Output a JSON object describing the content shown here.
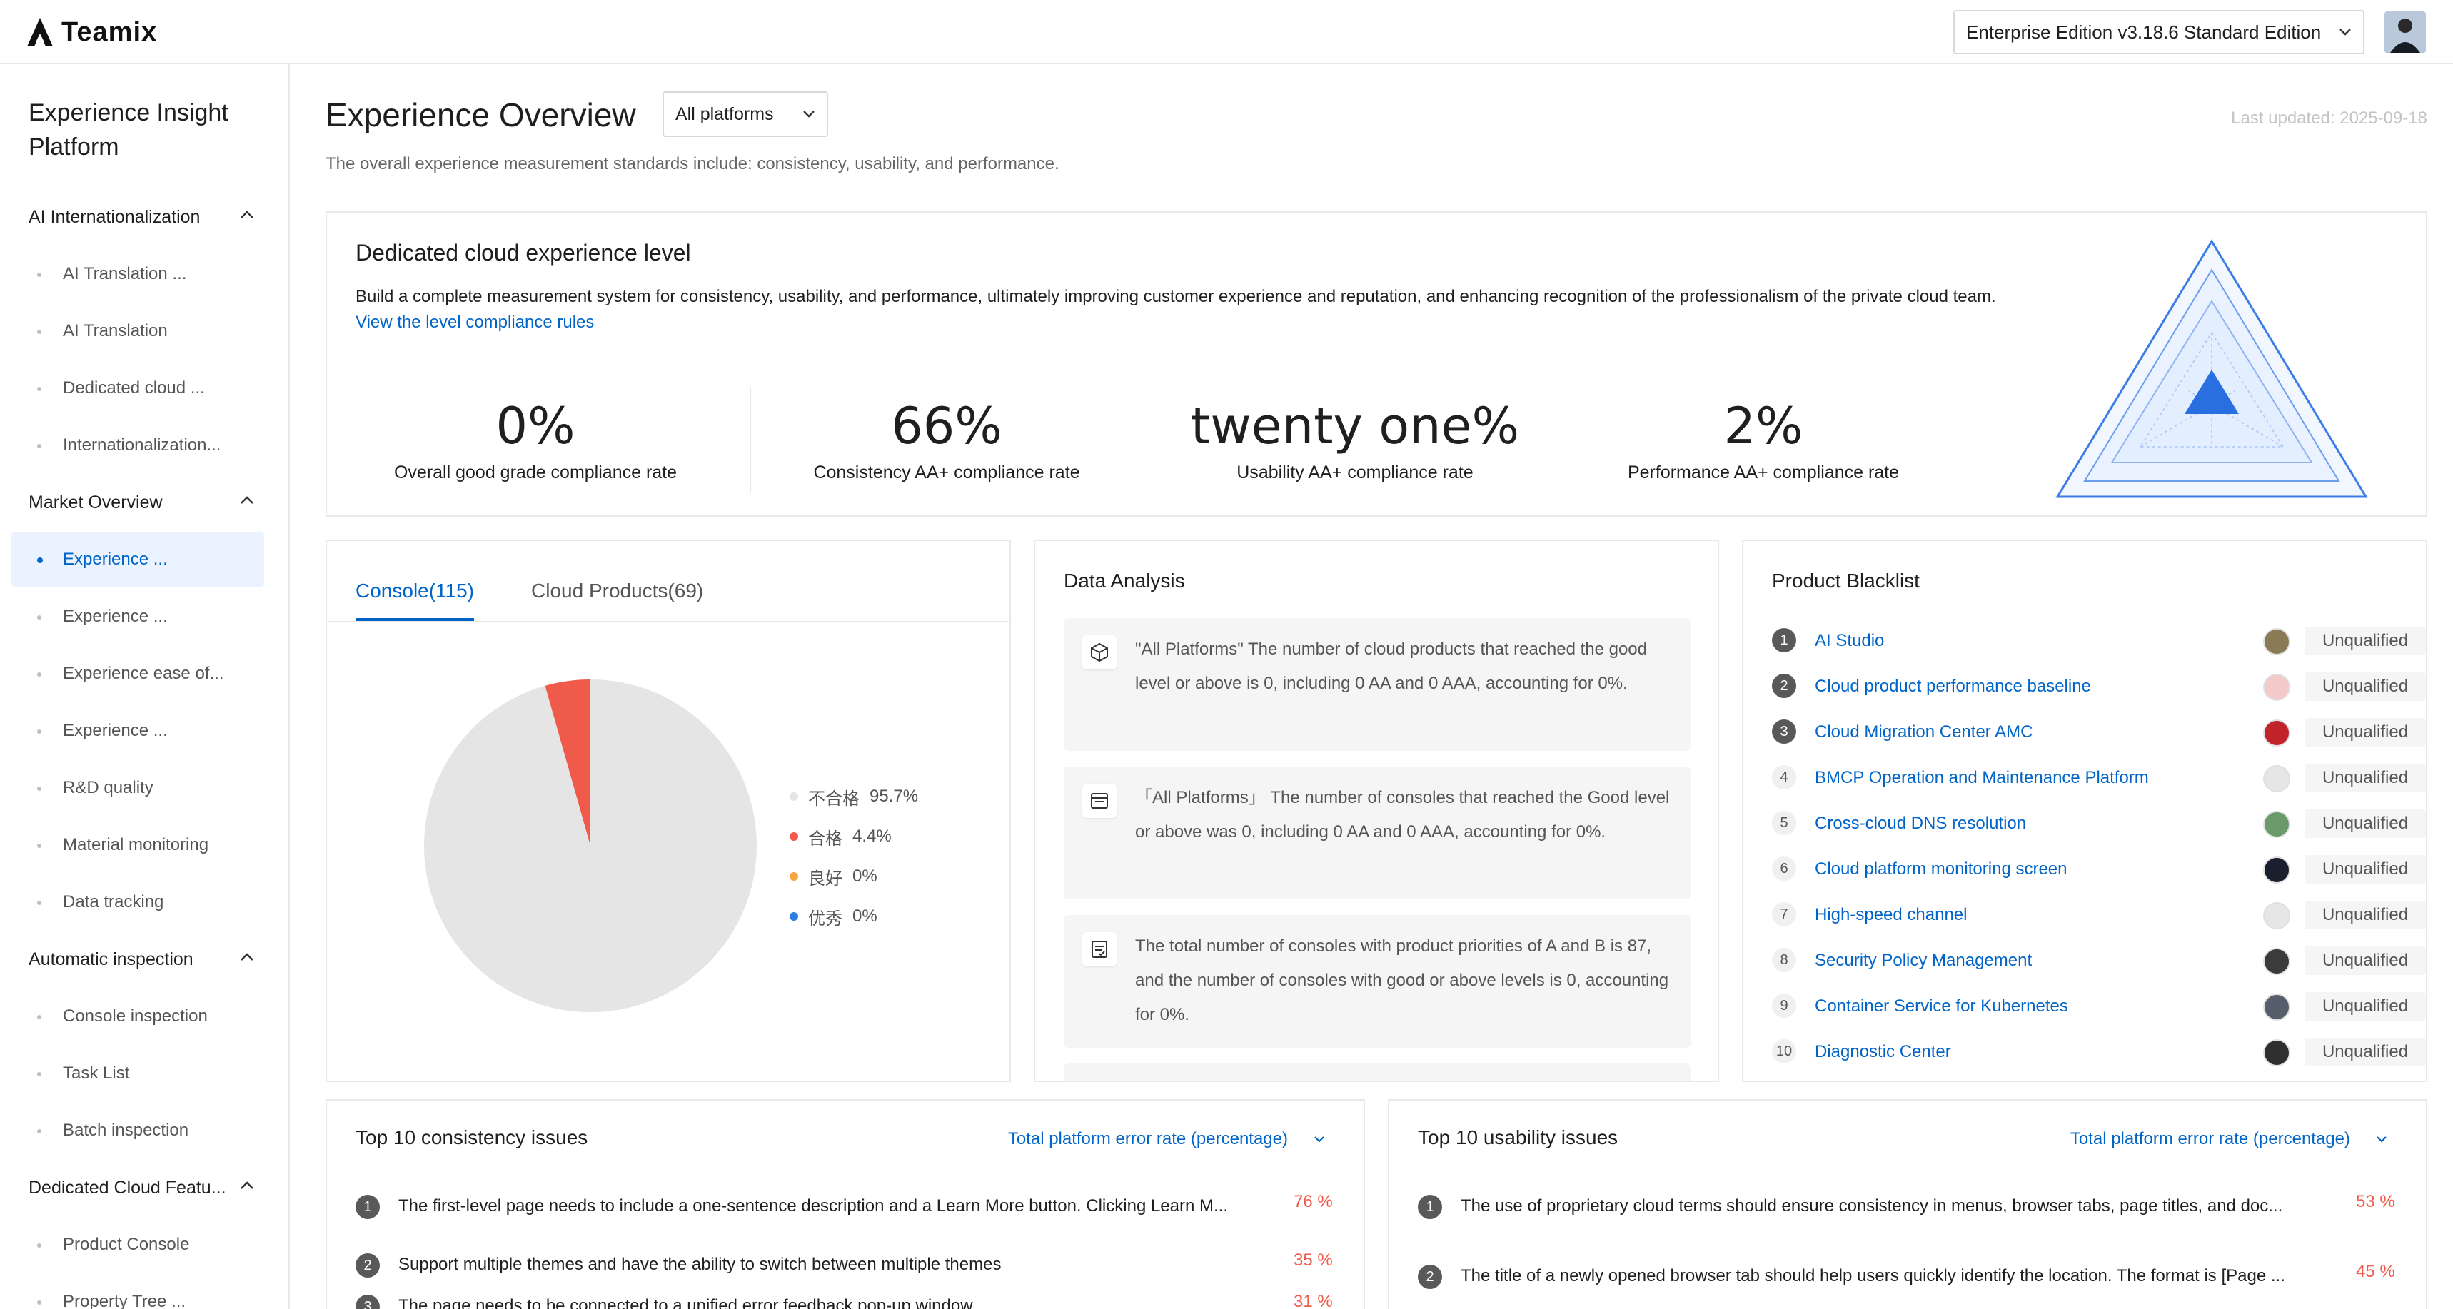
{
  "app": {
    "logo_text": "Teamix",
    "edition": "Enterprise Edition v3.18.6 Standard Edition"
  },
  "sidebar": {
    "title": "Experience Insight Platform",
    "groups": [
      {
        "label": "AI Internationalization",
        "items": [
          {
            "label": "AI Translation ..."
          },
          {
            "label": "AI Translation"
          },
          {
            "label": "Dedicated cloud ..."
          },
          {
            "label": "Internationalization..."
          }
        ]
      },
      {
        "label": "Market Overview",
        "items": [
          {
            "label": "Experience ...",
            "active": true
          },
          {
            "label": "Experience ..."
          },
          {
            "label": "Experience ease of..."
          },
          {
            "label": "Experience ..."
          },
          {
            "label": "R&D quality"
          },
          {
            "label": "Material monitoring"
          },
          {
            "label": "Data tracking"
          }
        ]
      },
      {
        "label": "Automatic inspection",
        "items": [
          {
            "label": "Console inspection"
          },
          {
            "label": "Task List"
          },
          {
            "label": "Batch inspection"
          }
        ]
      },
      {
        "label": "Dedicated Cloud Featu...",
        "items": [
          {
            "label": "Product Console"
          },
          {
            "label": "Property Tree ..."
          }
        ]
      }
    ]
  },
  "header": {
    "title": "Experience Overview",
    "platform_select": "All platforms",
    "last_updated": "Last updated: 2025-09-18",
    "subtitle": "The overall experience measurement standards include: consistency, usability, and performance."
  },
  "level": {
    "title": "Dedicated cloud experience level",
    "desc": "Build a complete measurement system for consistency, usability, and performance, ultimately improving customer experience and reputation, and enhancing recognition of the professionalism of the private cloud team.",
    "link": "View the level compliance rules",
    "metrics": [
      {
        "value": "0%",
        "label": "Overall good grade compliance rate"
      },
      {
        "value": "66%",
        "label": "Consistency AA+ compliance rate"
      },
      {
        "value": "twenty one%",
        "label": "Usability AA+ compliance rate"
      },
      {
        "value": "2%",
        "label": "Performance AA+ compliance rate"
      }
    ]
  },
  "tabs": {
    "items": [
      {
        "label": "Console(115)",
        "active": true
      },
      {
        "label": "Cloud Products(69)",
        "active": false
      }
    ]
  },
  "chart_data": {
    "type": "pie",
    "slices": [
      {
        "label": "不合格",
        "value": 95.7,
        "display": "95.7%",
        "color": "#e5e5e5"
      },
      {
        "label": "合格",
        "value": 4.4,
        "display": "4.4%",
        "color": "#f05a4a"
      },
      {
        "label": "良好",
        "value": 0,
        "display": "0%",
        "color": "#f7a541"
      },
      {
        "label": "优秀",
        "value": 0,
        "display": "0%",
        "color": "#2a7de1"
      }
    ]
  },
  "analysis": {
    "title": "Data Analysis",
    "items": [
      {
        "icon": "cube-icon",
        "text": "\"All Platforms\" The number of cloud products that reached the good level or above is 0, including 0 AA and 0 AAA, accounting for 0%."
      },
      {
        "icon": "window-icon",
        "text": "「All Platforms」 The number of consoles that reached the Good level or above was 0, including 0 AA and 0 AAA, accounting for 0%."
      },
      {
        "icon": "document-icon",
        "text": "The total number of consoles with product priorities of A and B is 87, and the number of consoles with good or above levels is 0, accounting for 0%."
      }
    ]
  },
  "blacklist": {
    "title": "Product Blacklist",
    "rows": [
      {
        "rank": "1",
        "name": "AI Studio",
        "status": "Unqualified"
      },
      {
        "rank": "2",
        "name": "Cloud product performance baseline",
        "status": "Unqualified"
      },
      {
        "rank": "3",
        "name": "Cloud Migration Center AMC",
        "status": "Unqualified"
      },
      {
        "rank": "4",
        "name": "BMCP Operation and Maintenance Platform",
        "status": "Unqualified"
      },
      {
        "rank": "5",
        "name": "Cross-cloud DNS resolution",
        "status": "Unqualified"
      },
      {
        "rank": "6",
        "name": "Cloud platform monitoring screen",
        "status": "Unqualified"
      },
      {
        "rank": "7",
        "name": "High-speed channel",
        "status": "Unqualified"
      },
      {
        "rank": "8",
        "name": "Security Policy Management",
        "status": "Unqualified"
      },
      {
        "rank": "9",
        "name": "Container Service for Kubernetes",
        "status": "Unqualified"
      },
      {
        "rank": "10",
        "name": "Diagnostic Center",
        "status": "Unqualified"
      }
    ]
  },
  "consistency": {
    "title": "Top 10 consistency issues",
    "select": "Total platform error rate (percentage)",
    "items": [
      {
        "rank": "1",
        "text": "The first-level page needs to include a one-sentence description and a Learn More button. Clicking Learn M...",
        "pct": "76 %"
      },
      {
        "rank": "2",
        "text": "Support multiple themes and have the ability to switch between multiple themes",
        "pct": "35 %"
      },
      {
        "rank": "3",
        "text": "The page needs to be connected to a unified error feedback pop-up window",
        "pct": "31 %"
      }
    ]
  },
  "usability": {
    "title": "Top 10 usability issues",
    "select": "Total platform error rate (percentage)",
    "items": [
      {
        "rank": "1",
        "text": "The use of proprietary cloud terms should ensure consistency in menus, browser tabs, page titles, and doc...",
        "pct": "53 %"
      },
      {
        "rank": "2",
        "text": "The title of a newly opened browser tab should help users quickly identify the location. The format is [Page ...",
        "pct": "45 %"
      }
    ]
  }
}
